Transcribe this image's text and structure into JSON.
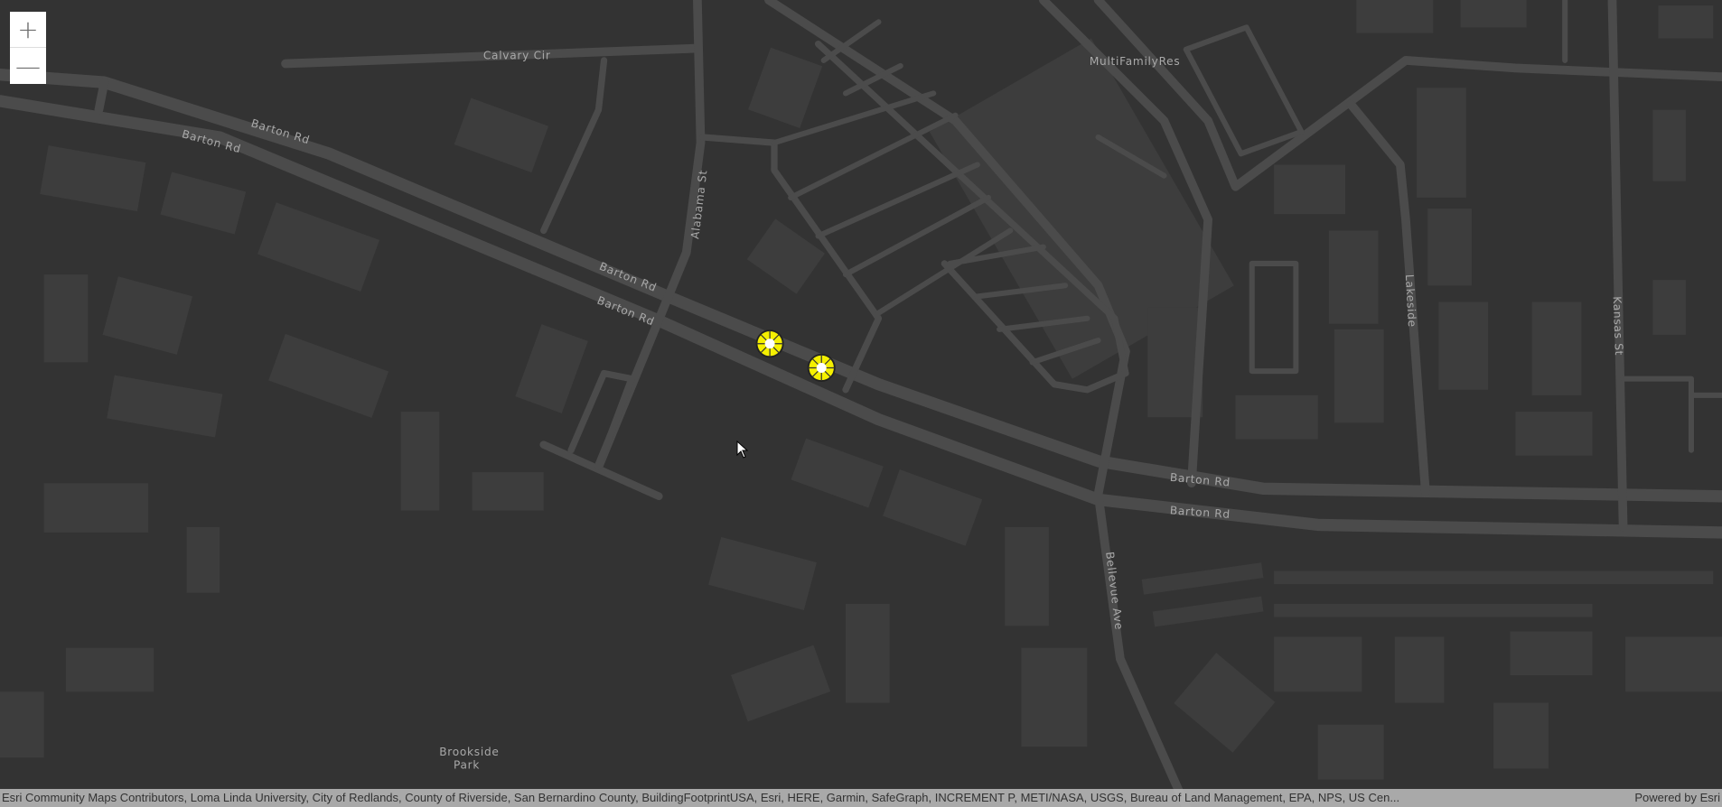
{
  "zoom_controls": {
    "zoom_in": "+",
    "zoom_out": "—"
  },
  "labels": {
    "calvary": "Calvary Cir",
    "barton1": "Barton Rd",
    "barton2": "Barton Rd",
    "barton3": "Barton Rd",
    "barton4": "Barton Rd",
    "barton5": "Barton Rd",
    "barton6": "Barton Rd",
    "alabama": "Alabama St",
    "multifamily": "MultiFamilyRes",
    "lakeside": "Lakeside",
    "kansas": "Kansas St",
    "bellevue": "Bellevue Ave",
    "brookside1": "Brookside",
    "brookside2": "Park"
  },
  "markers": {
    "color": "#f5f000",
    "count": 2
  },
  "attribution": {
    "sources": "Esri Community Maps Contributors, Loma Linda University, City of Redlands, County of Riverside, San Bernardino County, BuildingFootprintUSA, Esri, HERE, Garmin, SafeGraph, INCREMENT P, METI/NASA, USGS, Bureau of Land Management, EPA, NPS, US Cen...",
    "powered": "Powered by Esri"
  }
}
